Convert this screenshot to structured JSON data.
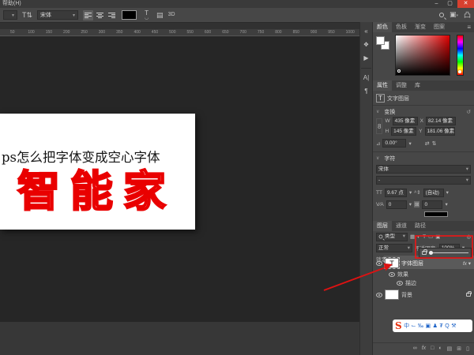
{
  "window": {
    "menu_label": "帮助(H)",
    "minimize": "–",
    "maximize": "▢",
    "close": "✕"
  },
  "options_bar": {
    "preset_value": "",
    "font_value": "宋体",
    "threed_label": "3D",
    "color_swatch": "#000000"
  },
  "ruler": {
    "ticks": [
      50,
      100,
      150,
      200,
      250,
      300,
      350,
      400,
      450,
      500,
      550,
      600,
      650,
      700,
      750,
      800,
      850,
      900,
      950,
      1000
    ]
  },
  "document": {
    "heading_text": "ps怎么把字体变成空心字体",
    "hollow_text": "智能家",
    "hollow_color": "#e90000"
  },
  "color_panel": {
    "tabs": [
      "颜色",
      "色板",
      "渐变",
      "图案"
    ]
  },
  "properties_panel": {
    "tabs": [
      "属性",
      "调整",
      "库"
    ],
    "layer_type": "文字图层",
    "transform": {
      "title": "变换",
      "w_label": "W",
      "w_value": "435 像素",
      "x_label": "X",
      "x_value": "82.14 像素",
      "h_label": "H",
      "h_value": "145 像素",
      "y_label": "Y",
      "y_value": "181.06 像素",
      "angle_value": "0.00°"
    },
    "character": {
      "title": "字符",
      "font": "宋体",
      "style": "-",
      "size": "9.67 点",
      "leading": "(自动)",
      "kerning": "0",
      "tracking": "0"
    }
  },
  "layers_panel": {
    "tabs": [
      "图层",
      "通道",
      "路径"
    ],
    "kind_label": "类型",
    "blend_mode": "正常",
    "opacity_label": "不透明度:",
    "opacity_value": "100%",
    "lock_label": "锁定:",
    "fill_label": "填充:",
    "fill_value": "0%",
    "text_layer_name": "字体图层",
    "fx_badge": "fx",
    "effects_label": "效果",
    "stroke_label": "描边",
    "background_label": "背景"
  },
  "watermark": {
    "logo": "S",
    "icons": [
      "中",
      "⌙",
      "‰",
      "▣",
      "♟",
      "₮",
      "Q",
      "⚒"
    ]
  },
  "annotation": {
    "color": "#e31212"
  }
}
